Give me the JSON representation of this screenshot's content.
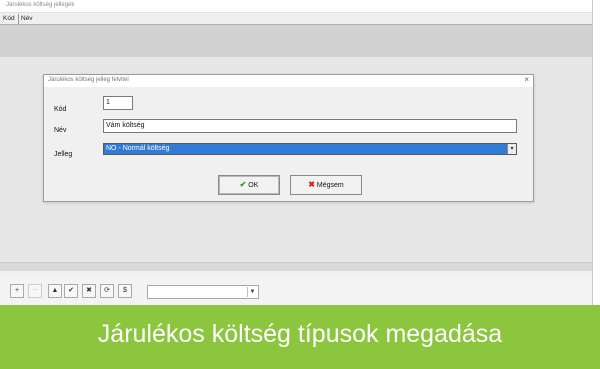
{
  "window": {
    "title": "Járulékos költség jellegek"
  },
  "grid": {
    "columns": [
      "Kód",
      "Név"
    ]
  },
  "dialog": {
    "title": "Járulékos költség jelleg felvitel",
    "close_label": "×",
    "fields": {
      "kod_label": "Kód",
      "kod_value": "1",
      "nev_label": "Név",
      "nev_value": "Vám költség",
      "jelleg_label": "Jelleg",
      "jelleg_value": "NO - Normál költség"
    },
    "ok_label": "OK",
    "cancel_label": "Mégsem"
  },
  "toolbar": {
    "buttons": [
      "+",
      "−",
      "▲",
      "✔",
      "✖",
      "⟳",
      "$"
    ],
    "combo_value": ""
  },
  "caption": {
    "text": "Járulékos költség típusok megadása",
    "color": "#8cc63f"
  }
}
